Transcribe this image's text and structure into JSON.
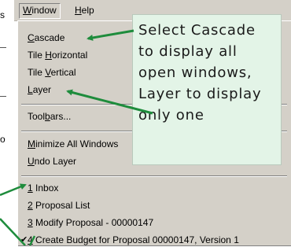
{
  "background_fragments": [
    "s",
    "o"
  ],
  "menubar": {
    "window": {
      "mnemonic": "W",
      "rest": "indow"
    },
    "help": {
      "mnemonic": "H",
      "rest": "elp"
    }
  },
  "menu": {
    "cascade": {
      "mnemonic": "C",
      "rest": "ascade"
    },
    "tile_horizontal": {
      "pre": "Tile ",
      "mnemonic": "H",
      "rest": "orizontal"
    },
    "tile_vertical": {
      "pre": "Tile ",
      "mnemonic": "V",
      "rest": "ertical"
    },
    "layer": {
      "mnemonic": "L",
      "rest": "ayer"
    },
    "toolbars": {
      "pre": "Tool",
      "mnemonic": "b",
      "rest": "ars..."
    },
    "minimize_all": {
      "mnemonic": "M",
      "rest": "inimize All Windows"
    },
    "undo_layer": {
      "mnemonic": "U",
      "rest": "ndo Layer"
    },
    "windows": [
      {
        "num": "1",
        "label": " Inbox"
      },
      {
        "num": "2",
        "label": " Proposal List"
      },
      {
        "num": "3",
        "label": " Modify Proposal - 00000147"
      },
      {
        "num": "4",
        "label": " Create Budget for Proposal 00000147, Version 1",
        "checked": true
      }
    ],
    "check_glyph": "✔"
  },
  "callout": {
    "lines": [
      "Select Cascade",
      "to display all",
      "open windows,",
      "Layer to display",
      "only one"
    ],
    "background": "#e3f4e7"
  },
  "colors": {
    "menu_face": "#d4d0c8",
    "arrow": "#1e8c3c"
  }
}
